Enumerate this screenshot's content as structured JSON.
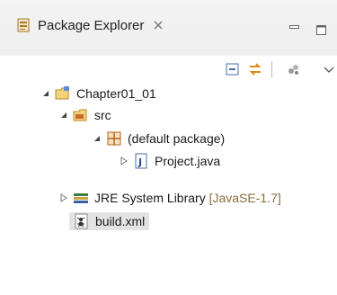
{
  "view": {
    "title": "Package Explorer",
    "close_glyph": "✕"
  },
  "toolbar": {
    "icons": [
      "collapse-all-icon",
      "link-with-editor-icon",
      "view-menu-group-icon",
      "view-menu-icon"
    ]
  },
  "tree": {
    "project": {
      "label": "Chapter01_01",
      "expanded": true,
      "icon": "project-folder-icon"
    },
    "src": {
      "label": "src",
      "expanded": true,
      "icon": "source-folder-icon"
    },
    "default_package": {
      "label": "(default package)",
      "expanded": true,
      "icon": "package-icon"
    },
    "project_java": {
      "label": "Project.java",
      "expanded": false,
      "icon": "java-file-icon"
    },
    "jre": {
      "label": "JRE System Library",
      "decoration": "[JavaSE-1.7]",
      "expanded": false,
      "icon": "library-icon"
    },
    "build_xml": {
      "label": "build.xml",
      "selected": true,
      "icon": "ant-file-icon"
    }
  },
  "colors": {
    "tab_bg": "#f0f0f0",
    "selection": "#e3e3e3",
    "decoration": "#8a6d3b"
  }
}
